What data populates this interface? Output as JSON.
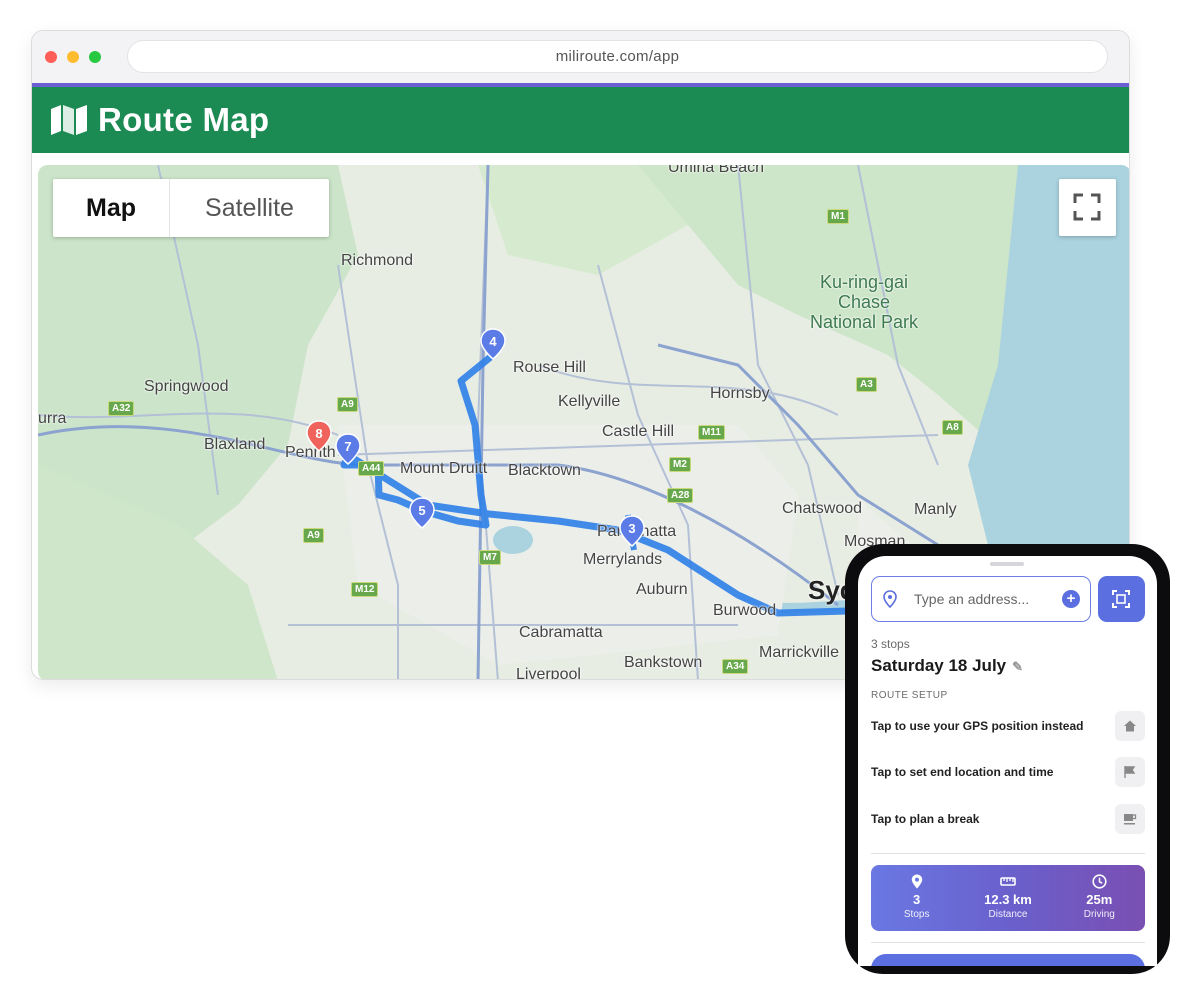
{
  "browser": {
    "url": "miliroute.com/app"
  },
  "app": {
    "title": "Route Map",
    "logo_icon": "map-icon",
    "brand_color": "#1b8a53",
    "accent_color": "#6b5fd3"
  },
  "map": {
    "view_tabs": [
      "Map",
      "Satellite"
    ],
    "active_view": "Map",
    "fullscreen_icon": "fullscreen-icon",
    "place_labels": {
      "richmond": "Richmond",
      "springwood": "Springwood",
      "blaxland": "Blaxland",
      "penrith": "Penrith",
      "mount_druitt": "Mount Druitt",
      "blacktown": "Blacktown",
      "rouse_hill": "Rouse Hill",
      "kellyville": "Kellyville",
      "castle_hill": "Castle Hill",
      "hornsby": "Hornsby",
      "chatswood": "Chatswood",
      "manly": "Manly",
      "parramatta": "Parramatta",
      "merrylands": "Merrylands",
      "auburn": "Auburn",
      "burwood": "Burwood",
      "cabramatta": "Cabramatta",
      "bankstown": "Bankstown",
      "marrickville": "Marrickville",
      "liverpool": "Liverpool",
      "sydney": "Syd",
      "mosman": "Mosman",
      "urra": "urra",
      "beach": "Umina Beach",
      "national_park": [
        "Ku-ring-gai",
        "Chase",
        "National Park"
      ]
    },
    "road_badges": [
      "M1",
      "A32",
      "A9",
      "A44",
      "A9",
      "M12",
      "M7",
      "A3",
      "A8",
      "M11",
      "M2",
      "A28",
      "A34"
    ],
    "markers": [
      {
        "label": "4",
        "color": "#5b7be6"
      },
      {
        "label": "8",
        "color": "#f0625c"
      },
      {
        "label": "7",
        "color": "#5b7be6"
      },
      {
        "label": "5",
        "color": "#5b7be6"
      },
      {
        "label": "3",
        "color": "#5b7be6"
      }
    ],
    "route_color": "#2f7fe8"
  },
  "panel": {
    "address_placeholder": "Type an address...",
    "stops_count": "3 stops",
    "date": "Saturday 18 July",
    "section_label": "ROUTE SETUP",
    "setup_rows": [
      {
        "label": "Tap to use your GPS position instead",
        "icon": "home-icon"
      },
      {
        "label": "Tap to set end location and time",
        "icon": "flag-icon"
      },
      {
        "label": "Tap to plan a break",
        "icon": "coffee-icon"
      }
    ],
    "stats": [
      {
        "value": "3",
        "label": "Stops",
        "icon": "pin-icon"
      },
      {
        "value": "12.3 km",
        "label": "Distance",
        "icon": "ruler-icon"
      },
      {
        "value": "25m",
        "label": "Driving",
        "icon": "clock-icon"
      }
    ],
    "primary_color": "#5b6fe0"
  }
}
